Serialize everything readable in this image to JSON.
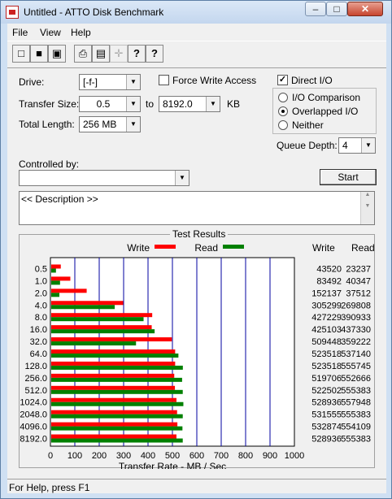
{
  "window": {
    "title": "Untitled - ATTO Disk Benchmark"
  },
  "menu": [
    "File",
    "View",
    "Help"
  ],
  "toolbar": [
    {
      "icon": "new-icon",
      "glyph": "□"
    },
    {
      "icon": "open-icon",
      "glyph": "■"
    },
    {
      "icon": "save-icon",
      "glyph": "▣"
    },
    {
      "icon": "print-icon",
      "glyph": "⎙"
    },
    {
      "icon": "print-preview-icon",
      "glyph": "▤"
    },
    {
      "icon": "move-icon",
      "glyph": "✛"
    },
    {
      "icon": "help-icon",
      "glyph": "?"
    },
    {
      "icon": "context-help-icon",
      "glyph": "?"
    }
  ],
  "form": {
    "drive_label": "Drive:",
    "drive_value": "[-f-]",
    "force_write_label": "Force Write Access",
    "force_write_checked": false,
    "direct_io_label": "Direct I/O",
    "direct_io_checked": true,
    "transfer_size_label": "Transfer Size:",
    "transfer_from": "0.5",
    "to_label": "to",
    "transfer_to": "8192.0",
    "kb_label": "KB",
    "total_length_label": "Total Length:",
    "total_length_value": "256 MB",
    "io_options": [
      {
        "label": "I/O Comparison",
        "selected": false
      },
      {
        "label": "Overlapped I/O",
        "selected": true
      },
      {
        "label": "Neither",
        "selected": false
      }
    ],
    "queue_depth_label": "Queue Depth:",
    "queue_depth_value": "4",
    "controlled_by_label": "Controlled by:",
    "controlled_by_value": "",
    "start_label": "Start",
    "description": "<< Description >>"
  },
  "results": {
    "title": "Test Results",
    "write_col": "Write",
    "read_col": "Read"
  },
  "chart_data": {
    "type": "bar",
    "orientation": "horizontal",
    "categories": [
      "0.5",
      "1.0",
      "2.0",
      "4.0",
      "8.0",
      "16.0",
      "32.0",
      "64.0",
      "128.0",
      "256.0",
      "512.0",
      "1024.0",
      "2048.0",
      "4096.0",
      "8192.0"
    ],
    "series": [
      {
        "name": "Write",
        "color": "#ff0000",
        "values": [
          43520,
          83492,
          152137,
          305299,
          427229,
          425103,
          509448,
          523518,
          523518,
          519706,
          522502,
          528936,
          531555,
          532874,
          528936
        ]
      },
      {
        "name": "Read",
        "color": "#008000",
        "values": [
          23237,
          40347,
          37512,
          269808,
          390933,
          437330,
          359222,
          537140,
          555745,
          552666,
          555383,
          557948,
          555383,
          554109,
          555383
        ]
      }
    ],
    "xlabel": "Transfer Rate - MB / Sec",
    "xticks": [
      "0",
      "100",
      "200",
      "300",
      "400",
      "500",
      "600",
      "700",
      "800",
      "900",
      "1000"
    ],
    "xlim": [
      0,
      1000
    ],
    "legend": "top",
    "grid": true
  },
  "status": {
    "text": "For Help, press F1"
  }
}
